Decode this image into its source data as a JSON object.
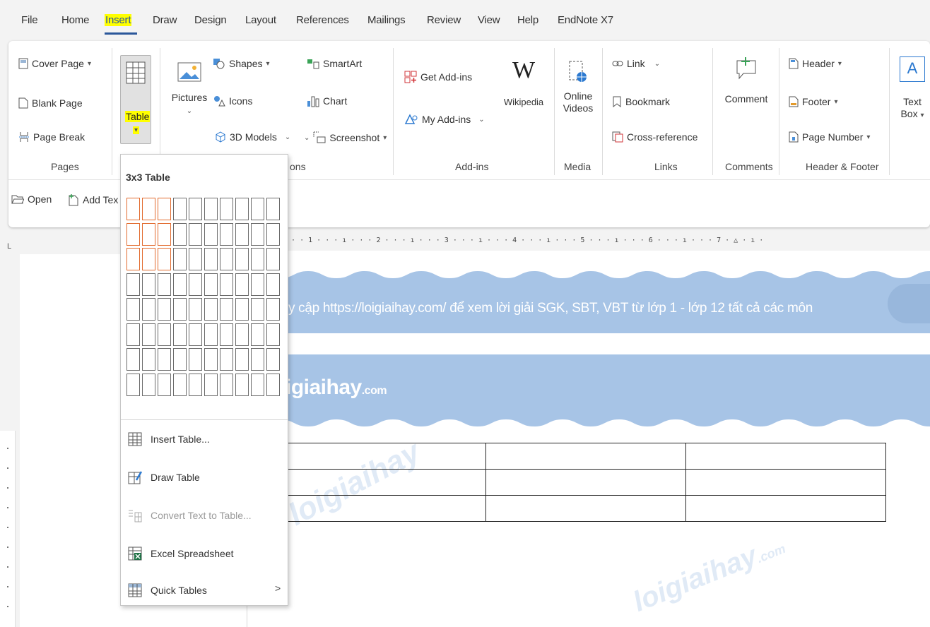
{
  "menubar": {
    "tabs": [
      "File",
      "Home",
      "Insert",
      "Draw",
      "Design",
      "Layout",
      "References",
      "Mailings",
      "Review",
      "View",
      "Help",
      "EndNote X7"
    ],
    "active_tab": "Insert",
    "active_highlight_color": "#ffff00"
  },
  "ribbon": {
    "pages": {
      "cover_page": "Cover Page",
      "blank_page": "Blank Page",
      "page_break": "Page Break",
      "group_label": "Pages"
    },
    "tables": {
      "table": "Table"
    },
    "illustrations": {
      "pictures": "Pictures",
      "shapes": "Shapes",
      "icons": "Icons",
      "models_3d": "3D Models",
      "smartart": "SmartArt",
      "chart": "Chart",
      "screenshot": "Screenshot",
      "group_label_partial": "ons"
    },
    "addins": {
      "get_addins": "Get Add-ins",
      "my_addins": "My Add-ins",
      "wikipedia_glyph": "W",
      "wikipedia": "Wikipedia",
      "group_label": "Add-ins"
    },
    "media": {
      "online": "Online",
      "videos": "Videos",
      "group_label": "Media"
    },
    "links": {
      "link": "Link",
      "bookmark": "Bookmark",
      "cross_reference": "Cross-reference",
      "group_label": "Links"
    },
    "comments": {
      "comment": "Comment",
      "group_label": "Comments"
    },
    "header_footer": {
      "header": "Header",
      "footer": "Footer",
      "page_number": "Page Number",
      "group_label": "Header & Footer"
    },
    "text": {
      "text": "Text",
      "box": "Box",
      "glyph": "A"
    }
  },
  "endnote_bar": {
    "open": "Open",
    "add_text_partial": "Add Tex"
  },
  "document": {
    "ruler_corner": "L",
    "ruler_text": "· · · 1 · · · ı · · · 2 · · · ı · · · 3 · · · ı · · · 4 · · · ı · · · 5 · · · ı · · · 6 · · · ı · · · 7 · △ · ı ·",
    "banner1_text": "y cập https://loigiaihay.com/ để xem lời giải SGK, SBT, VBT từ lớp 1 - lớp 12 tất cả các môn",
    "banner2_brand": "igiaihay",
    "banner2_suffix": ".com",
    "watermark_text": "loigiaihay",
    "watermark_suffix": ".com",
    "banner_color": "#a7c4e6",
    "table_rows": 3,
    "table_cols": 3
  },
  "table_dropdown": {
    "title": "3x3 Table",
    "grid_columns": 10,
    "grid_rows": 8,
    "selected_columns": 3,
    "selected_rows": 3,
    "selection_color": "#e26b2e",
    "items": [
      {
        "label": "Insert Table...",
        "icon": "insert-table-icon",
        "enabled": true
      },
      {
        "label": "Draw Table",
        "icon": "draw-table-icon",
        "enabled": true
      },
      {
        "label": "Convert Text to Table...",
        "icon": "convert-text-to-table-icon",
        "enabled": false
      },
      {
        "label": "Excel Spreadsheet",
        "icon": "excel-spreadsheet-icon",
        "enabled": true
      },
      {
        "label": "Quick Tables",
        "icon": "quick-tables-icon",
        "enabled": true,
        "submenu_arrow": ">"
      }
    ]
  }
}
